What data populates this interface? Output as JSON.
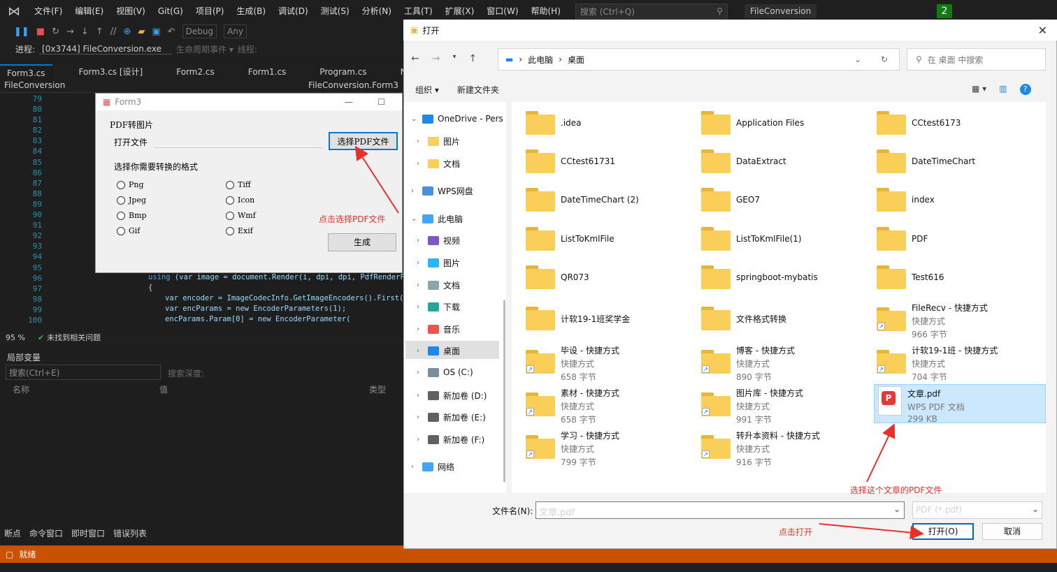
{
  "vs": {
    "menu": [
      "文件(F)",
      "编辑(E)",
      "视图(V)",
      "Git(G)",
      "项目(P)",
      "生成(B)",
      "调试(D)",
      "测试(S)",
      "分析(N)",
      "工具(T)",
      "扩展(X)",
      "窗口(W)",
      "帮助(H)"
    ],
    "search_placeholder": "搜索 (Ctrl+Q)",
    "solution_name": "FileConversion",
    "badge": "2",
    "config": "Debug",
    "platform": "Any",
    "process_label": "进程:",
    "process_value": "[0x3744] FileConversion.exe",
    "lifecycle": "生命周期事件 ▾",
    "thread_label": "线程:",
    "tabs": [
      "Form3.cs",
      "Form3.cs [设计]",
      "Form2.cs",
      "Form1.cs",
      "Program.cs",
      "N"
    ],
    "nav_left": "FileConversion",
    "nav_right": "FileConversion.Form3",
    "line_numbers": [
      "79",
      "80",
      "81",
      "82",
      "83",
      "84",
      "85",
      "86",
      "87",
      "88",
      "89",
      "90",
      "91",
      "92",
      "93",
      "94",
      "95",
      "96",
      "97",
      "98",
      "99",
      "100"
    ],
    "code": {
      "l96_kw": "using",
      "l96_text": " (var image = document.Render(i, dpi, dpi, PdfRenderFla",
      "l97": "{",
      "l98": "var encoder = ImageCodecInfo.GetImageEncoders().First(c",
      "l99": "var encParams = new EncoderParameters(1);",
      "l100": "encParams.Param[0] = new EncoderParameter("
    },
    "zoom": "95 %",
    "issues": "未找到相关问题",
    "locals_title": "局部变量",
    "locals_search": "搜索(Ctrl+E)",
    "search_depth": "搜索深度:",
    "col_name": "名称",
    "col_value": "值",
    "col_type": "类型",
    "bottom_tabs": [
      "断点",
      "命令窗口",
      "即时窗口",
      "错误列表"
    ],
    "status": "就绪"
  },
  "form3": {
    "title": "Form3",
    "group_title": "PDF转图片",
    "open_file_label": "打开文件",
    "choose_btn": "选择PDF文件",
    "format_label": "选择你需要转换的格式",
    "formats_left": [
      "Png",
      "Jpeg",
      "Bmp",
      "Gif"
    ],
    "formats_right": [
      "Tiff",
      "Icon",
      "Wmf",
      "Exif"
    ],
    "generate_btn": "生成"
  },
  "annotations": {
    "click_choose": "点击选择PDF文件",
    "choose_article": "选择这个文章的PDF文件",
    "click_open": "点击打开"
  },
  "dialog": {
    "title": "打开",
    "breadcrumb": [
      "此电脑",
      "桌面"
    ],
    "search_placeholder": "在 桌面 中搜索",
    "organize": "组织 ▾",
    "new_folder": "新建文件夹",
    "tree": [
      {
        "label": "OneDrive - Pers",
        "expanded": true,
        "color": "#1e88e5"
      },
      {
        "label": "图片",
        "expanded": false,
        "color": "#f9cf5a"
      },
      {
        "label": "文档",
        "expanded": false,
        "color": "#f9cf5a"
      },
      {
        "label": "WPS网盘",
        "expanded": false,
        "color": "#4a90e2"
      },
      {
        "label": "此电脑",
        "expanded": true,
        "color": "#42a5f5"
      },
      {
        "label": "视频",
        "expanded": false,
        "color": "#7e57c2"
      },
      {
        "label": "图片",
        "expanded": false,
        "color": "#29b6f6"
      },
      {
        "label": "文档",
        "expanded": false,
        "color": "#90a4ae"
      },
      {
        "label": "下载",
        "expanded": false,
        "color": "#26a69a"
      },
      {
        "label": "音乐",
        "expanded": false,
        "color": "#ef5350"
      },
      {
        "label": "桌面",
        "expanded": false,
        "color": "#1e88e5"
      },
      {
        "label": "OS (C:)",
        "expanded": false,
        "color": "#78909c"
      },
      {
        "label": "新加卷 (D:)",
        "expanded": false,
        "color": "#616161"
      },
      {
        "label": "新加卷 (E:)",
        "expanded": false,
        "color": "#616161"
      },
      {
        "label": "新加卷 (F:)",
        "expanded": false,
        "color": "#616161"
      },
      {
        "label": "网络",
        "expanded": false,
        "color": "#42a5f5"
      }
    ],
    "folders": [
      ".idea",
      "Application Files",
      "CCtest6173",
      "CCtest61731",
      "DataExtract",
      "DateTimeChart",
      "DateTimeChart (2)",
      "GEO7",
      "index",
      "ListToKmlFile",
      "ListToKmlFile(1)",
      "PDF",
      "QR073",
      "springboot-mybatis",
      "Test616",
      "计软19-1班奖学金",
      "文件格式转换"
    ],
    "shortcuts": [
      {
        "name": "FileRecv - 快捷方式",
        "type": "快捷方式",
        "size": "966 字节"
      },
      {
        "name": "毕设 - 快捷方式",
        "type": "快捷方式",
        "size": "658 字节"
      },
      {
        "name": "博客 - 快捷方式",
        "type": "快捷方式",
        "size": "890 字节"
      },
      {
        "name": "计软19-1班 - 快捷方式",
        "type": "快捷方式",
        "size": "704 字节"
      },
      {
        "name": "素材 - 快捷方式",
        "type": "快捷方式",
        "size": "658 字节"
      },
      {
        "name": "图片库 - 快捷方式",
        "type": "快捷方式",
        "size": "991 字节"
      },
      {
        "name": "学习 - 快捷方式",
        "type": "快捷方式",
        "size": "799 字节"
      },
      {
        "name": "转升本资料 - 快捷方式",
        "type": "快捷方式",
        "size": "916 字节"
      }
    ],
    "pdf_file": {
      "name": "文章.pdf",
      "type": "WPS PDF 文档",
      "size": "299 KB"
    },
    "filename_label": "文件名(N):",
    "filename_value": "文章.pdf",
    "filetype": "PDF  (*.pdf)",
    "open_btn": "打开(O)",
    "cancel_btn": "取消"
  },
  "colors": {
    "accent": "#0067c0",
    "annotation": "#e8302a",
    "statusbar": "#ca5100",
    "selected": "#cce8ff"
  }
}
